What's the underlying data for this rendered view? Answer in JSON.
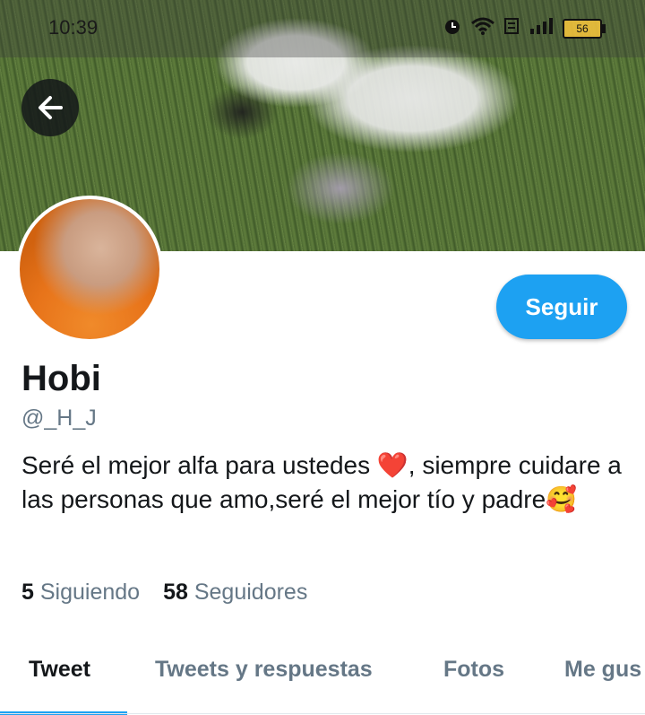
{
  "status_bar": {
    "time": "10:39",
    "battery": "56",
    "icons": [
      "alarm-icon",
      "wifi-icon",
      "volte-icon",
      "signal-icon",
      "battery-icon"
    ]
  },
  "profile": {
    "name": "Hobi",
    "handle": "@_H_J",
    "follow_label": "Seguir",
    "bio_part1": "Seré el mejor alfa para ustedes",
    "bio_heart": "❤️",
    "bio_part2": ", siempre cuidare a las personas que amo,seré el mejor tío y padre",
    "bio_emoji": "🥰",
    "following_count": "5",
    "following_label": "Siguiendo",
    "followers_count": "58",
    "followers_label": "Seguidores"
  },
  "tabs": [
    {
      "label": "Tweet",
      "active": true
    },
    {
      "label": "Tweets y respuestas",
      "active": false
    },
    {
      "label": "Fotos",
      "active": false
    },
    {
      "label": "Me gus",
      "active": false
    }
  ],
  "colors": {
    "accent": "#1da1f2",
    "secondary_text": "#657786",
    "primary_text": "#14171a"
  }
}
